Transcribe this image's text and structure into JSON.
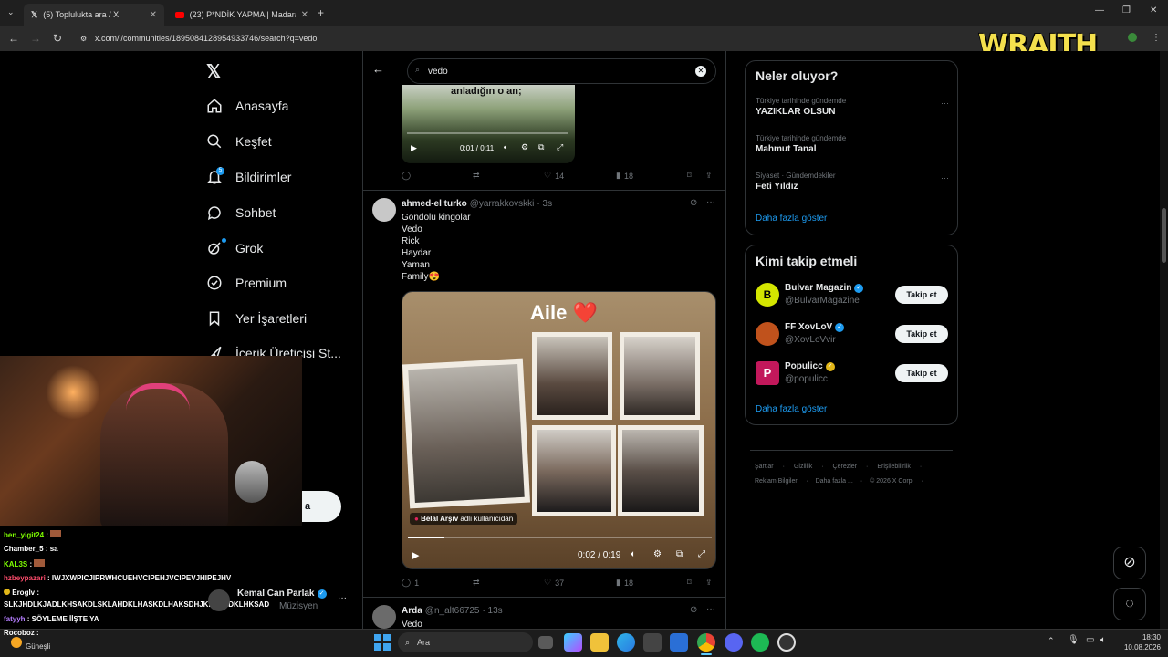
{
  "browser": {
    "tabs": [
      {
        "title": "(5) Toplulukta ara / X",
        "active": true
      },
      {
        "title": "(23) P*NDİK YAPMA | Madara O",
        "active": false
      }
    ],
    "url": "x.com/i/communities/1895084128954933746/search?q=vedo"
  },
  "overlay_logo": "WRAITH",
  "sidebar": {
    "items": [
      {
        "label": "Anasayfa",
        "icon": "home-icon"
      },
      {
        "label": "Keşfet",
        "icon": "search-icon"
      },
      {
        "label": "Bildirimler",
        "icon": "bell-icon"
      },
      {
        "label": "Sohbet",
        "icon": "chat-icon"
      },
      {
        "label": "Grok",
        "icon": "grok-icon"
      },
      {
        "label": "Premium",
        "icon": "premium-icon"
      },
      {
        "label": "Yer İşaretleri",
        "icon": "bookmark-icon"
      },
      {
        "label": "İçerik Üreticisi St...",
        "icon": "creator-icon"
      }
    ],
    "notification_badge": "5",
    "post_button_fragment": "a"
  },
  "search": {
    "value": "vedo"
  },
  "tweets": [
    {
      "video_caption": "anladığın o an;",
      "time": "0:01 / 0:11",
      "replies": "",
      "reposts": "",
      "likes": "14",
      "views": "18"
    },
    {
      "name": "ahmed-el turko",
      "handle": "@yarrakkovskki",
      "time_ago": "· 3s",
      "lines": [
        "Gondolu kingolar",
        "Vedo",
        "Rick",
        "Haydar",
        "Yaman",
        "Family😍"
      ],
      "image_title": "Aile ❤️",
      "image_credit_user": "Belal Arşiv",
      "image_credit_suffix": "adlı kullanıcıdan",
      "video_time": "0:02 / 0:19",
      "replies": "1",
      "reposts": "",
      "likes": "37",
      "views": "18"
    },
    {
      "name": "Arda",
      "handle": "@n_alt66725",
      "time_ago": "· 13s",
      "lines": [
        "Vedo"
      ]
    }
  ],
  "trends": {
    "title": "Neler oluyor?",
    "items": [
      {
        "category": "Türkiye tarihinde gündemde",
        "name": "YAZIKLAR OLSUN"
      },
      {
        "category": "Türkiye tarihinde gündemde",
        "name": "Mahmut Tanal"
      },
      {
        "category": "Siyaset · Gündemdekiler",
        "name": "Feti Yıldız"
      }
    ],
    "more": "Daha fazla göster"
  },
  "who_to_follow": {
    "title": "Kimi takip etmeli",
    "items": [
      {
        "name": "Bulvar Magazin",
        "handle": "@BulvarMagazine",
        "verified_color": "#1d9bf0",
        "avatar_color": "#d4e600",
        "avatar_letter": "B"
      },
      {
        "name": "FF XovLoV",
        "handle": "@XovLoVvir",
        "verified_color": "#1d9bf0",
        "avatar_color": "#c0521c",
        "avatar_letter": ""
      },
      {
        "name": "Populicc",
        "handle": "@populicc",
        "verified_color": "#e2b719",
        "avatar_color": "#c2185b",
        "avatar_letter": "P"
      }
    ],
    "follow_label": "Takip et",
    "more": "Daha fazla göster"
  },
  "footer": {
    "row1": [
      "Şartlar",
      "Gizlilik",
      "Çerezler",
      "Erişilebilirlik"
    ],
    "row2": [
      "Reklam Bilgileri",
      "Daha fazla ...",
      "© 2026 X Corp."
    ]
  },
  "chat": [
    {
      "user": "ben_yigit24",
      "color": "#7fff00",
      "text": ":"
    },
    {
      "user": "Chamber_5",
      "color": "#ffffff",
      "text": ": sa"
    },
    {
      "user": "KAL3S",
      "color": "#7fff00",
      "text": ":"
    },
    {
      "user": "hzbeypazari",
      "color": "#ff4d6d",
      "text": ": IWJXWPICJIPRWHCUEHVCIPEHJVCIPEVJHIPEJHV"
    },
    {
      "user": "Eroglv",
      "color": "#ffffff",
      "text": ":"
    },
    {
      "user": "",
      "color": "#ffffff",
      "text": "SLKJHDLKJADLKHSAKDLSKLAHDKLHASKDLHAKSDHJKLSAHDKLHKSAD"
    },
    {
      "user": "fatyyh",
      "color": "#b57dff",
      "text": ": SÖYLEME İİŞTE YA"
    },
    {
      "user": "Rocoboz",
      "color": "#ffffff",
      "text": ":"
    }
  ],
  "chat_overlap_profile": {
    "name": "Kemal Can Parlak",
    "role": "Müzisyen"
  },
  "taskbar": {
    "weather": "Güneşli",
    "search": "Ara",
    "time": "18:30",
    "date": "10.08.2026"
  },
  "colors": {
    "accent": "#1d9bf0",
    "background": "#000000",
    "border": "#2f3336"
  }
}
